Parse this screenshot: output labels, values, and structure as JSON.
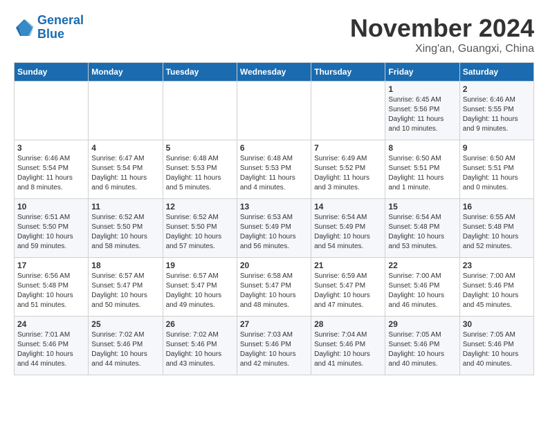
{
  "header": {
    "logo_line1": "General",
    "logo_line2": "Blue",
    "month": "November 2024",
    "location": "Xing'an, Guangxi, China"
  },
  "days_of_week": [
    "Sunday",
    "Monday",
    "Tuesday",
    "Wednesday",
    "Thursday",
    "Friday",
    "Saturday"
  ],
  "weeks": [
    [
      {
        "day": "",
        "info": ""
      },
      {
        "day": "",
        "info": ""
      },
      {
        "day": "",
        "info": ""
      },
      {
        "day": "",
        "info": ""
      },
      {
        "day": "",
        "info": ""
      },
      {
        "day": "1",
        "info": "Sunrise: 6:45 AM\nSunset: 5:56 PM\nDaylight: 11 hours and 10 minutes."
      },
      {
        "day": "2",
        "info": "Sunrise: 6:46 AM\nSunset: 5:55 PM\nDaylight: 11 hours and 9 minutes."
      }
    ],
    [
      {
        "day": "3",
        "info": "Sunrise: 6:46 AM\nSunset: 5:54 PM\nDaylight: 11 hours and 8 minutes."
      },
      {
        "day": "4",
        "info": "Sunrise: 6:47 AM\nSunset: 5:54 PM\nDaylight: 11 hours and 6 minutes."
      },
      {
        "day": "5",
        "info": "Sunrise: 6:48 AM\nSunset: 5:53 PM\nDaylight: 11 hours and 5 minutes."
      },
      {
        "day": "6",
        "info": "Sunrise: 6:48 AM\nSunset: 5:53 PM\nDaylight: 11 hours and 4 minutes."
      },
      {
        "day": "7",
        "info": "Sunrise: 6:49 AM\nSunset: 5:52 PM\nDaylight: 11 hours and 3 minutes."
      },
      {
        "day": "8",
        "info": "Sunrise: 6:50 AM\nSunset: 5:51 PM\nDaylight: 11 hours and 1 minute."
      },
      {
        "day": "9",
        "info": "Sunrise: 6:50 AM\nSunset: 5:51 PM\nDaylight: 11 hours and 0 minutes."
      }
    ],
    [
      {
        "day": "10",
        "info": "Sunrise: 6:51 AM\nSunset: 5:50 PM\nDaylight: 10 hours and 59 minutes."
      },
      {
        "day": "11",
        "info": "Sunrise: 6:52 AM\nSunset: 5:50 PM\nDaylight: 10 hours and 58 minutes."
      },
      {
        "day": "12",
        "info": "Sunrise: 6:52 AM\nSunset: 5:50 PM\nDaylight: 10 hours and 57 minutes."
      },
      {
        "day": "13",
        "info": "Sunrise: 6:53 AM\nSunset: 5:49 PM\nDaylight: 10 hours and 56 minutes."
      },
      {
        "day": "14",
        "info": "Sunrise: 6:54 AM\nSunset: 5:49 PM\nDaylight: 10 hours and 54 minutes."
      },
      {
        "day": "15",
        "info": "Sunrise: 6:54 AM\nSunset: 5:48 PM\nDaylight: 10 hours and 53 minutes."
      },
      {
        "day": "16",
        "info": "Sunrise: 6:55 AM\nSunset: 5:48 PM\nDaylight: 10 hours and 52 minutes."
      }
    ],
    [
      {
        "day": "17",
        "info": "Sunrise: 6:56 AM\nSunset: 5:48 PM\nDaylight: 10 hours and 51 minutes."
      },
      {
        "day": "18",
        "info": "Sunrise: 6:57 AM\nSunset: 5:47 PM\nDaylight: 10 hours and 50 minutes."
      },
      {
        "day": "19",
        "info": "Sunrise: 6:57 AM\nSunset: 5:47 PM\nDaylight: 10 hours and 49 minutes."
      },
      {
        "day": "20",
        "info": "Sunrise: 6:58 AM\nSunset: 5:47 PM\nDaylight: 10 hours and 48 minutes."
      },
      {
        "day": "21",
        "info": "Sunrise: 6:59 AM\nSunset: 5:47 PM\nDaylight: 10 hours and 47 minutes."
      },
      {
        "day": "22",
        "info": "Sunrise: 7:00 AM\nSunset: 5:46 PM\nDaylight: 10 hours and 46 minutes."
      },
      {
        "day": "23",
        "info": "Sunrise: 7:00 AM\nSunset: 5:46 PM\nDaylight: 10 hours and 45 minutes."
      }
    ],
    [
      {
        "day": "24",
        "info": "Sunrise: 7:01 AM\nSunset: 5:46 PM\nDaylight: 10 hours and 44 minutes."
      },
      {
        "day": "25",
        "info": "Sunrise: 7:02 AM\nSunset: 5:46 PM\nDaylight: 10 hours and 44 minutes."
      },
      {
        "day": "26",
        "info": "Sunrise: 7:02 AM\nSunset: 5:46 PM\nDaylight: 10 hours and 43 minutes."
      },
      {
        "day": "27",
        "info": "Sunrise: 7:03 AM\nSunset: 5:46 PM\nDaylight: 10 hours and 42 minutes."
      },
      {
        "day": "28",
        "info": "Sunrise: 7:04 AM\nSunset: 5:46 PM\nDaylight: 10 hours and 41 minutes."
      },
      {
        "day": "29",
        "info": "Sunrise: 7:05 AM\nSunset: 5:46 PM\nDaylight: 10 hours and 40 minutes."
      },
      {
        "day": "30",
        "info": "Sunrise: 7:05 AM\nSunset: 5:46 PM\nDaylight: 10 hours and 40 minutes."
      }
    ]
  ]
}
